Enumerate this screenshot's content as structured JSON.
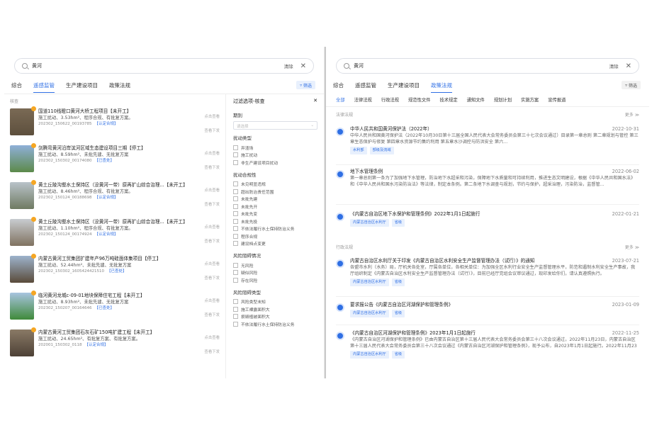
{
  "search": {
    "value": "黄河",
    "clear": "清除",
    "close": "✕"
  },
  "left": {
    "tabs": [
      "综合",
      "遥感监管",
      "生产建设项目",
      "政策法规"
    ],
    "filter": "筛选",
    "section": "核查",
    "items": [
      {
        "title": "国道110线瞪口黄河大桥工程项目【未开工】",
        "l2": "施工扰动、3.53hm²、程序合规、有批复方案。",
        "l3": "202302_150622_00193785",
        "tag": "【认定合规】",
        "side1": "点击查看",
        "side2": "查看下发"
      },
      {
        "title": "剑腾弯黄河沿岸滨河区域生态建设项目三期【停工】",
        "l2": "施工扰动、8.59hm²、未批先建、无批复方案",
        "l3": "202302_150302_00174080",
        "tag": "【已查处】",
        "side1": "点击查看",
        "side2": "查看下发"
      },
      {
        "title": "黄土丘陵沟壑水土保持区（没黄河一带）原再扩山综合治理...【未开工】",
        "l2": "施工扰动、8.46hm²、程序合规、有批复方案。",
        "l3": "202302_150124_00188698",
        "tag": "【认定合规】",
        "side1": "点击查看",
        "side2": "查看下发"
      },
      {
        "title": "黄土丘陵沟壑水土保持区（没黄河一带）原再扩山综合治理...【未开工】",
        "l2": "施工扰动、1.10hm²、程序合规、有批复方案。",
        "l3": "202302_150124_00174924",
        "tag": "【认定合规】",
        "side1": "点击查看",
        "side2": "查看下发"
      },
      {
        "title": "内蒙古黄河工贸集团扩建年产96万吨硅面体集项目【停工】",
        "l2": "施工扰动、52.44hm²、未批先建、无批复方案",
        "l3": "202302_150302_1605424421510",
        "tag": "【已查处】",
        "side1": "点击查看",
        "side2": "查看下发"
      },
      {
        "title": "临河黄河龙城c-09-01地块保障住宅工程【未开工】",
        "l2": "施工扰动、8.93hm²、未批先建、无批复方案",
        "l3": "202302_150207_00164646",
        "tag": "【已查处】",
        "side1": "点击查看",
        "side2": "查看下发"
      },
      {
        "title": "内蒙古黄河工贸集团石灰石矿150吨扩建工程【未开工】",
        "l2": "施工扰动、24.65hm²、有批复方案、有批复方案。",
        "l3": "202001_150302_0118",
        "tag": "【认定合规】",
        "side1": "点击查看",
        "side2": "查看下发"
      }
    ],
    "panel": {
      "title": "过滤选项-核查",
      "close": "✕",
      "g1": "期别",
      "select": "请选择",
      "g2": "扰动类型",
      "g2o": [
        "弃渣场",
        "施工扰动",
        "非生产建设项目扰动"
      ],
      "g3": "扰动合规性",
      "g3o": [
        "未见明显违规",
        "超出防治责任范围",
        "未批先建",
        "未批先开",
        "未批先变",
        "未批先投",
        "不依法履行水土保持防治义务",
        "程序合规",
        "建设档点变更"
      ],
      "g4": "风险阻碍情况",
      "g4o": [
        "无风险",
        "疑似风险",
        "存在风险"
      ],
      "g5": "风险阻碍类型",
      "g5o": [
        "风险类型未知",
        "施工裸露面积大",
        "损毁植被面积大",
        "不依法履行水土保持防治义务"
      ]
    }
  },
  "right": {
    "tabs": [
      "综合",
      "遥感监管",
      "生产建设项目",
      "政策法规"
    ],
    "filter": "筛选",
    "subtabs": [
      "全部",
      "法律法规",
      "行政法规",
      "规范性文件",
      "技术规定",
      "通知文件",
      "规划计划",
      "实施方案",
      "宣传报道"
    ],
    "sec1": "法律法规",
    "sec2": "行政法规",
    "more": "更多 ≫",
    "laws": [
      {
        "title": "中华人民共和国黄河保护法（2022年）",
        "date": "2022-10-31",
        "text": "中华人民共和国黄河保护法（2022年10月30日第十三届全国人民代表大会常务委员会第三十七次会议通过）目录第一章总则 第二章规划与管控 第三章生态保护与修复 第四章水资源节约集约利用 第五章水沙调控与防洪安全 第六...",
        "tags": [
          "水利部",
          "部级及流域"
        ]
      },
      {
        "title": "地下水管理条例",
        "date": "2022-06-02",
        "text": "第一章总则第一条为了加强地下水管理，防治地下水超采和污染，保障地下水质量和可持续利用，推进生态文明建设，根据《中华人民共和国水法》和《中华人民共和国水污染防治法》等法律，制定本条例。第二条地下水调查与规划，节约与保护，超采治理，污染防治，监督管...",
        "tags": []
      },
      {
        "title": "《内蒙古自治区地下水保护和管理条例》2022年1月1日起施行",
        "date": "2022-01-21",
        "text": "",
        "tags": [
          "内蒙古自治区水利厅",
          "省级"
        ]
      },
      {
        "title": "内蒙古自治区水利厅关于印发《内蒙古自治区水利安全生产监督管理办法（试行）》的通知",
        "date": "2023-07-21",
        "text": "各盟市水利（水务）局，厅机关各处室，厅属各单位，各相关单位：为加强全区水利行业安全生产监督管理水平，防范和遏制水利安全生产事故，我厅组织制定《内蒙古自治区水利安全生产监督管理办法（试行）》，目前已经厅党组会议审议通过，现印发给你们，请认真遵照执行。",
        "tags": [
          "内蒙古自治区水利厅",
          "省级"
        ]
      },
      {
        "title": "要求报公告《内蒙古自治区河湖保护和管理条例》",
        "date": "2023-01-09",
        "text": "",
        "tags": [
          "内蒙古自治区水利厅",
          "省级"
        ]
      },
      {
        "title": "《内蒙古自治区河湖保护和管理条例》2023年1月1日起施行",
        "date": "2022-11-25",
        "text": "《内蒙古自治区河湖保护和管理条例》已由内蒙古自治区第十三届人民代表大会常务委员会第三十八次会议通过，2022年11月23日，内蒙古自治区第十三届人民代表大会常务委员会第三十八次会议通过《内蒙古自治区河湖保护和管理条例》，现予公布，自2023年1月1日起施行。2022年11月23日内蒙古自治区河湖管理条...",
        "tags": [
          "内蒙古自治区水利厅",
          "省级"
        ]
      }
    ]
  }
}
